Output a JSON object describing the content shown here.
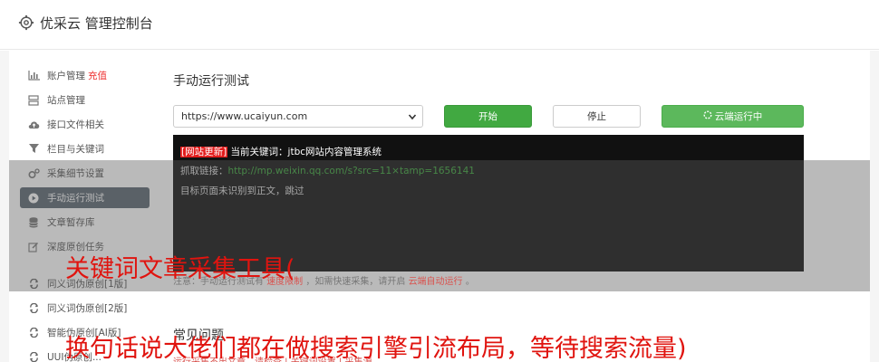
{
  "header": {
    "title": "优采云 管理控制台"
  },
  "sidebar": {
    "items": [
      {
        "label": "账户管理",
        "badge": "充值",
        "icon": "bar-chart-icon"
      },
      {
        "label": "站点管理",
        "icon": "server-icon"
      },
      {
        "label": "接口文件相关",
        "icon": "cloud-upload-icon"
      },
      {
        "label": "栏目与关键词",
        "icon": "filter-icon"
      },
      {
        "label": "采集细节设置",
        "icon": "gears-icon"
      },
      {
        "label": "手动运行测试",
        "icon": "play-circle-icon",
        "active": true
      },
      {
        "label": "文章暂存库",
        "icon": "database-icon"
      },
      {
        "label": "深度原创任务",
        "icon": "edit-icon"
      },
      {
        "label": "同义词伪原创[1版]",
        "icon": "refresh-icon"
      },
      {
        "label": "同义词伪原创[2版]",
        "icon": "refresh-icon"
      },
      {
        "label": "智能伪原创[AI版]",
        "icon": "refresh-icon"
      },
      {
        "label": "UUI伪原创...",
        "icon": "refresh-icon"
      }
    ]
  },
  "main": {
    "title": "手动运行测试",
    "url_select": {
      "value": "https://www.ucaiyun.com"
    },
    "buttons": {
      "start": "开始",
      "stop": "停止",
      "cloud_run": "云端运行中",
      "cloud_icon": "spinner-icon"
    },
    "console": {
      "line1_tag": "[网站更新]",
      "line1_text": " 当前关键词：jtbc网站内容管理系统",
      "line2_label": "抓取链接：",
      "line2_link": "http://mp.weixin.qq.com/s?src=11×tamp=1656141",
      "line3_text": "目标页面未识别到正文，跳过"
    },
    "notice": {
      "prefix": "注意：手动运行测试有",
      "limit": "速度限制",
      "middle": "，如需快速采集，请开启",
      "cloud": "云端自动运行",
      "suffix": "。"
    },
    "faq": {
      "title": "常见问题",
      "links": "运行采集不出文章，请检查 | 关键词设置 | 采集源"
    }
  },
  "overlay_text": {
    "line1": "关键词文章采集工具(",
    "line2": "换句话说大佬们都在做搜索引擎引流布局，等待搜索流量)"
  },
  "colors": {
    "accent_green": "#41a941",
    "cloud_green": "#5cb85c",
    "active_sidebar": "#5b6670",
    "red": "#e21c1c"
  }
}
